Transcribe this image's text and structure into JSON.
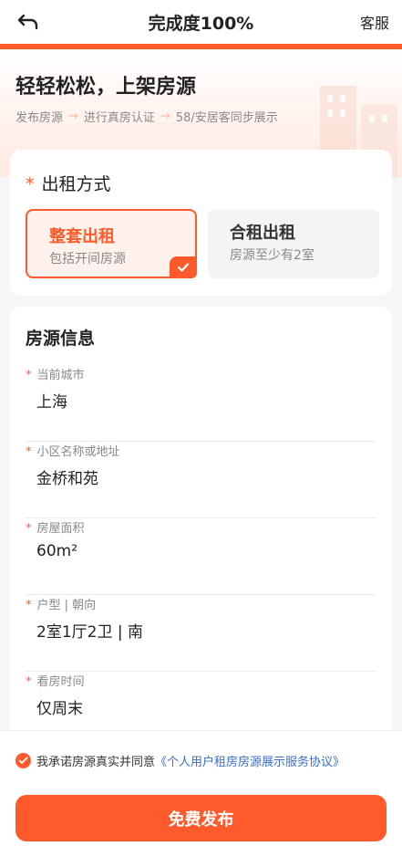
{
  "header": {
    "title": "完成度100%",
    "service_label": "客服",
    "progress_fraction": 1.0
  },
  "hero": {
    "title": "轻轻松松，上架房源",
    "steps": [
      "发布房源",
      "进行真房认证",
      "58/安居客同步展示"
    ],
    "arrow": "→"
  },
  "rent_mode": {
    "required_mark": "*",
    "label": "出租方式",
    "options": [
      {
        "title": "整套出租",
        "subtitle": "包括开间房源",
        "selected": true
      },
      {
        "title": "合租出租",
        "subtitle": "房源至少有2室",
        "selected": false
      }
    ]
  },
  "house_info": {
    "title": "房源信息",
    "fields": [
      {
        "label": "当前城市",
        "value": "上海"
      },
      {
        "label": "小区名称或地址",
        "value": "金桥和苑"
      },
      {
        "label": "房屋面积",
        "value": "60m²"
      },
      {
        "label": "户型 | 朝向",
        "value": "2室1厅2卫 | 南"
      },
      {
        "label": "看房时间",
        "value": "仅周末"
      }
    ]
  },
  "footer": {
    "agree_text": "我承诺房源真实并同意",
    "agree_link": "《个人用户租房房源展示服务协议》",
    "publish_label": "免费发布"
  },
  "colors": {
    "accent": "#ff5a2b",
    "link": "#3a6ecc"
  }
}
